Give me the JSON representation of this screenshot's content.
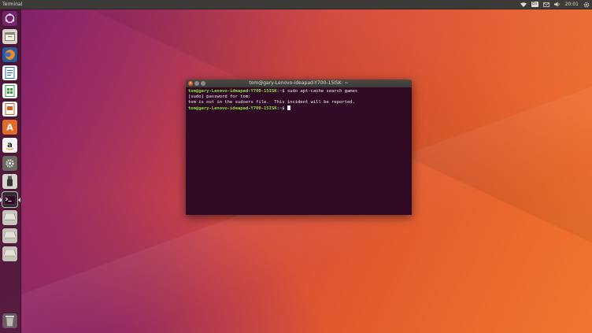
{
  "top_panel": {
    "app_title": "Terminal",
    "keyboard_indicator": "En",
    "time": "20:01",
    "icons": [
      "wifi-icon",
      "keyboard-layout-icon",
      "mail-icon",
      "volume-icon",
      "gear-icon"
    ]
  },
  "launcher": {
    "items": [
      "dash-icon",
      "files-icon",
      "firefox-icon",
      "writer-icon",
      "calc-icon",
      "impress-icon",
      "software-center-icon",
      "amazon-icon",
      "system-settings-icon",
      "usb-creator-icon",
      "terminal-icon",
      "drive-icon",
      "drive-icon",
      "drive-icon",
      "trash-icon"
    ]
  },
  "terminal": {
    "title": "tom@gary-Lenovo-ideapad-Y700-15ISK: ~",
    "lines": [
      {
        "user": "tom@gary-Lenovo-ideapad-Y700-15ISK",
        "path": ":~",
        "cmd": "$ sudo apt-cache search games"
      },
      {
        "text": "[sudo] password for tom:"
      },
      {
        "text": "tom is not in the sudoers file.  This incident will be reported."
      },
      {
        "user": "tom@gary-Lenovo-ideapad-Y700-15ISK",
        "path": ":~",
        "cmd": "$ "
      }
    ]
  },
  "colors": {
    "panel": "#3c3b37",
    "terminal_bg": "#300a24",
    "prompt_user": "#8ae234",
    "prompt_path": "#729fcf",
    "accent": "#e95420"
  }
}
